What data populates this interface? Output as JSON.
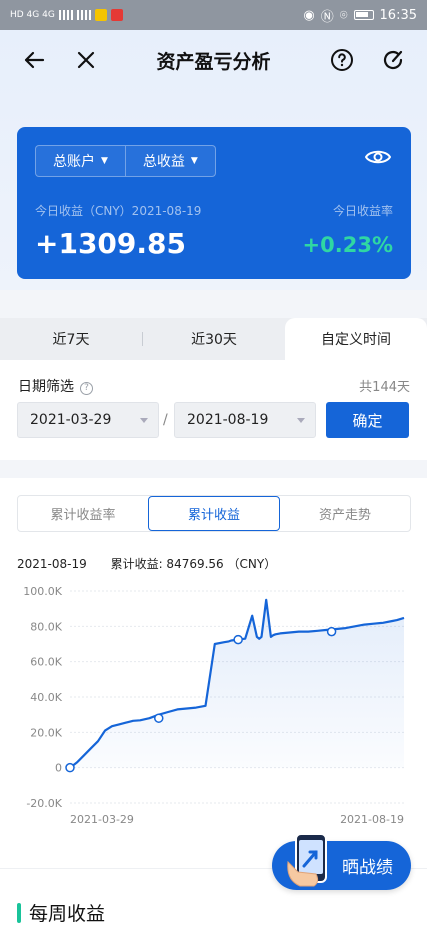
{
  "statusbar": {
    "left_text": "HD 4G 4G",
    "time": "16:35"
  },
  "header": {
    "title": "资产盈亏分析",
    "back_icon": "arrow-left-icon",
    "close_icon": "close-icon",
    "help_icon": "help-circle-icon",
    "refresh_icon": "refresh-icon"
  },
  "summary": {
    "account_label": "总账户",
    "metric_label": "总收益",
    "date_label": "今日收益（CNY）2021-08-19",
    "rate_label": "今日收益率",
    "value": "+1309.85",
    "rate": "+0.23%",
    "brand_color": "#1565d8",
    "rate_color": "#2fd7a3"
  },
  "period_tabs": [
    {
      "label": "近7天",
      "active": false
    },
    {
      "label": "近30天",
      "active": false
    },
    {
      "label": "自定义时间",
      "active": true
    }
  ],
  "filter": {
    "label": "日期筛选",
    "count": "共144天",
    "start_date": "2021-03-29",
    "end_date": "2021-08-19",
    "separator": "/",
    "confirm_label": "确定"
  },
  "chart_tabs": [
    {
      "label": "累计收益率",
      "active": false
    },
    {
      "label": "累计收益",
      "active": true
    },
    {
      "label": "资产走势",
      "active": false
    }
  ],
  "chart_info": {
    "date": "2021-08-19",
    "summary": "累计收益: 84769.56 （CNY）"
  },
  "chart_data": {
    "type": "area",
    "title": "",
    "xlabel": "",
    "ylabel": "",
    "x_tick_labels": [
      "2021-03-29",
      "2021-08-19"
    ],
    "y_tick_labels": [
      "100.0K",
      "80.0K",
      "60.0K",
      "40.0K",
      "20.0K",
      "0",
      "-20.0K"
    ],
    "ylim": [
      -20000,
      100000
    ],
    "xlim": [
      0,
      143
    ],
    "grid": true,
    "series": [
      {
        "color": "#1565d8",
        "x": [
          0,
          3,
          6,
          9,
          12,
          15,
          18,
          21,
          24,
          27,
          30,
          34,
          38,
          42,
          46,
          50,
          54,
          58,
          62,
          66,
          68,
          69,
          72,
          75,
          78,
          80,
          81,
          82,
          84,
          86,
          87,
          88,
          90,
          94,
          98,
          102,
          106,
          110,
          114,
          118,
          122,
          126,
          130,
          134,
          138,
          140,
          143
        ],
        "values": [
          0,
          3000,
          7000,
          11000,
          15000,
          21000,
          23500,
          24500,
          25500,
          26500,
          26800,
          28000,
          30000,
          31500,
          33000,
          33500,
          34000,
          35000,
          70000,
          71000,
          71500,
          72000,
          72500,
          73000,
          86000,
          74000,
          73000,
          74000,
          95000,
          74000,
          75000,
          75500,
          76000,
          76500,
          77000,
          77000,
          77500,
          78000,
          78500,
          79000,
          80000,
          81000,
          81500,
          82000,
          83000,
          83500,
          84770
        ]
      }
    ],
    "markers": [
      {
        "x": 0,
        "y": 0
      },
      {
        "x": 38,
        "y": 28000
      },
      {
        "x": 72,
        "y": 72500
      },
      {
        "x": 112,
        "y": 77000
      }
    ]
  },
  "share": {
    "label": "晒战绩",
    "icon": "phone-share-icon"
  },
  "weekly": {
    "title": "每周收益"
  }
}
